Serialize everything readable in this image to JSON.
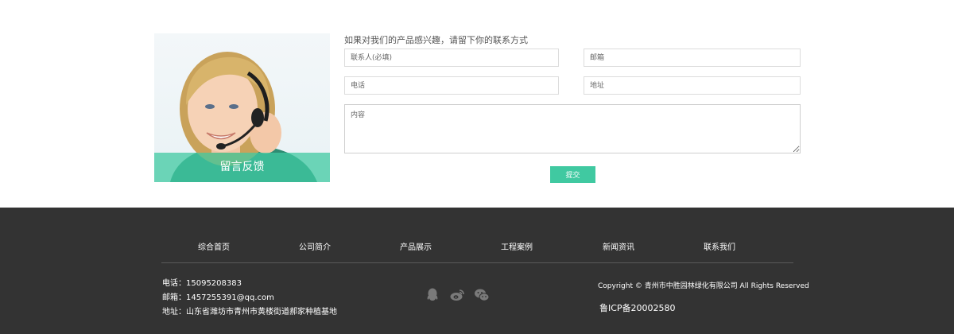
{
  "feedback": {
    "caption": "留言反馈",
    "intro": "如果对我们的产品感兴趣，请留下你的联系方式",
    "name_placeholder": "联系人(必填)",
    "email_placeholder": "邮箱",
    "phone_placeholder": "电话",
    "address_placeholder": "地址",
    "content_placeholder": "内容",
    "submit_label": "提交",
    "accent_color": "#40c9a1"
  },
  "footer": {
    "background_color": "#333333",
    "nav": [
      "综合首页",
      "公司简介",
      "产品展示",
      "工程案例",
      "新闻资讯",
      "联系我们"
    ],
    "phone": "电话：15095208383",
    "email": "邮箱：1457255391@qq.com",
    "address": "地址：山东省潍坊市青州市黄楼街道郝家种植基地",
    "social_icons": [
      "qq-icon",
      "weibo-icon",
      "wechat-icon"
    ],
    "copyright": "Copyright © 青州市中胜园林绿化有限公司 All Rights Reserved",
    "icp": "鲁ICP备20002580"
  }
}
